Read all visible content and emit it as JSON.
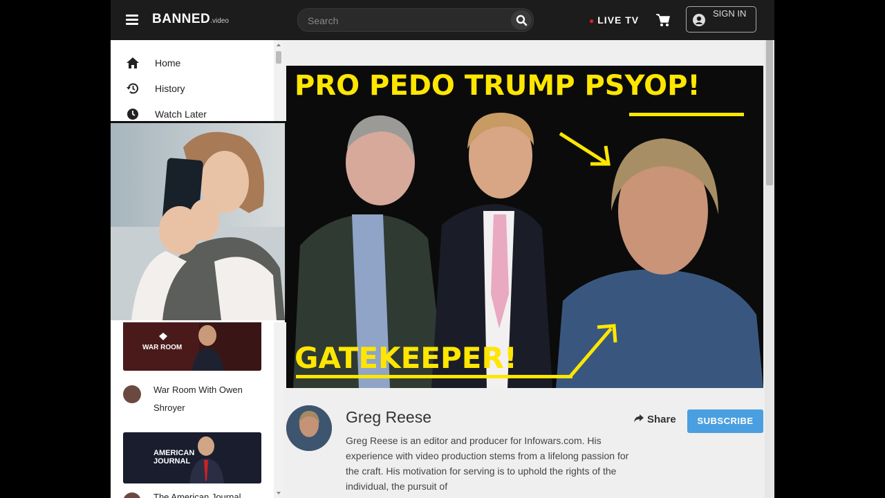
{
  "header": {
    "logo_main": "BANNED",
    "logo_sub": ".video",
    "search_placeholder": "Search",
    "live_label": "LIVE TV",
    "signin_label": "SIGN IN"
  },
  "sidebar": {
    "items": [
      {
        "label": "Home",
        "icon": "home-icon"
      },
      {
        "label": "History",
        "icon": "history-icon"
      },
      {
        "label": "Watch Later",
        "icon": "clock-icon"
      }
    ],
    "shows": [
      {
        "thumb_title": "WAR ROOM",
        "name": "War Room With Owen Shroyer"
      },
      {
        "thumb_title": "AMERICAN JOURNAL",
        "name": "The American Journal"
      }
    ]
  },
  "hero": {
    "headline_part1": "PRO PEDO TRUMP ",
    "headline_part2": "PSYOP!",
    "bottom_text": "GATEKEEPER!"
  },
  "channel": {
    "name": "Greg Reese",
    "description": "Greg Reese is an editor and producer for Infowars.com. His experience with video production stems from a lifelong passion for the craft. His motivation for serving is to uphold the rights of the individual, the pursuit of",
    "share_label": "Share",
    "subscribe_label": "SUBSCRIBE"
  },
  "colors": {
    "accent_yellow": "#ffe600",
    "subscribe_blue": "#4a9fe0",
    "live_red": "#e02020"
  }
}
